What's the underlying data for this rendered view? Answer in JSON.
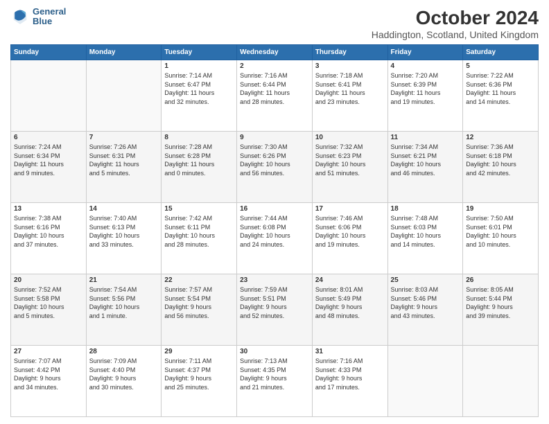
{
  "logo": {
    "line1": "General",
    "line2": "Blue"
  },
  "title": "October 2024",
  "subtitle": "Haddington, Scotland, United Kingdom",
  "header_days": [
    "Sunday",
    "Monday",
    "Tuesday",
    "Wednesday",
    "Thursday",
    "Friday",
    "Saturday"
  ],
  "weeks": [
    [
      {
        "day": "",
        "info": ""
      },
      {
        "day": "",
        "info": ""
      },
      {
        "day": "1",
        "info": "Sunrise: 7:14 AM\nSunset: 6:47 PM\nDaylight: 11 hours\nand 32 minutes."
      },
      {
        "day": "2",
        "info": "Sunrise: 7:16 AM\nSunset: 6:44 PM\nDaylight: 11 hours\nand 28 minutes."
      },
      {
        "day": "3",
        "info": "Sunrise: 7:18 AM\nSunset: 6:41 PM\nDaylight: 11 hours\nand 23 minutes."
      },
      {
        "day": "4",
        "info": "Sunrise: 7:20 AM\nSunset: 6:39 PM\nDaylight: 11 hours\nand 19 minutes."
      },
      {
        "day": "5",
        "info": "Sunrise: 7:22 AM\nSunset: 6:36 PM\nDaylight: 11 hours\nand 14 minutes."
      }
    ],
    [
      {
        "day": "6",
        "info": "Sunrise: 7:24 AM\nSunset: 6:34 PM\nDaylight: 11 hours\nand 9 minutes."
      },
      {
        "day": "7",
        "info": "Sunrise: 7:26 AM\nSunset: 6:31 PM\nDaylight: 11 hours\nand 5 minutes."
      },
      {
        "day": "8",
        "info": "Sunrise: 7:28 AM\nSunset: 6:28 PM\nDaylight: 11 hours\nand 0 minutes."
      },
      {
        "day": "9",
        "info": "Sunrise: 7:30 AM\nSunset: 6:26 PM\nDaylight: 10 hours\nand 56 minutes."
      },
      {
        "day": "10",
        "info": "Sunrise: 7:32 AM\nSunset: 6:23 PM\nDaylight: 10 hours\nand 51 minutes."
      },
      {
        "day": "11",
        "info": "Sunrise: 7:34 AM\nSunset: 6:21 PM\nDaylight: 10 hours\nand 46 minutes."
      },
      {
        "day": "12",
        "info": "Sunrise: 7:36 AM\nSunset: 6:18 PM\nDaylight: 10 hours\nand 42 minutes."
      }
    ],
    [
      {
        "day": "13",
        "info": "Sunrise: 7:38 AM\nSunset: 6:16 PM\nDaylight: 10 hours\nand 37 minutes."
      },
      {
        "day": "14",
        "info": "Sunrise: 7:40 AM\nSunset: 6:13 PM\nDaylight: 10 hours\nand 33 minutes."
      },
      {
        "day": "15",
        "info": "Sunrise: 7:42 AM\nSunset: 6:11 PM\nDaylight: 10 hours\nand 28 minutes."
      },
      {
        "day": "16",
        "info": "Sunrise: 7:44 AM\nSunset: 6:08 PM\nDaylight: 10 hours\nand 24 minutes."
      },
      {
        "day": "17",
        "info": "Sunrise: 7:46 AM\nSunset: 6:06 PM\nDaylight: 10 hours\nand 19 minutes."
      },
      {
        "day": "18",
        "info": "Sunrise: 7:48 AM\nSunset: 6:03 PM\nDaylight: 10 hours\nand 14 minutes."
      },
      {
        "day": "19",
        "info": "Sunrise: 7:50 AM\nSunset: 6:01 PM\nDaylight: 10 hours\nand 10 minutes."
      }
    ],
    [
      {
        "day": "20",
        "info": "Sunrise: 7:52 AM\nSunset: 5:58 PM\nDaylight: 10 hours\nand 5 minutes."
      },
      {
        "day": "21",
        "info": "Sunrise: 7:54 AM\nSunset: 5:56 PM\nDaylight: 10 hours\nand 1 minute."
      },
      {
        "day": "22",
        "info": "Sunrise: 7:57 AM\nSunset: 5:54 PM\nDaylight: 9 hours\nand 56 minutes."
      },
      {
        "day": "23",
        "info": "Sunrise: 7:59 AM\nSunset: 5:51 PM\nDaylight: 9 hours\nand 52 minutes."
      },
      {
        "day": "24",
        "info": "Sunrise: 8:01 AM\nSunset: 5:49 PM\nDaylight: 9 hours\nand 48 minutes."
      },
      {
        "day": "25",
        "info": "Sunrise: 8:03 AM\nSunset: 5:46 PM\nDaylight: 9 hours\nand 43 minutes."
      },
      {
        "day": "26",
        "info": "Sunrise: 8:05 AM\nSunset: 5:44 PM\nDaylight: 9 hours\nand 39 minutes."
      }
    ],
    [
      {
        "day": "27",
        "info": "Sunrise: 7:07 AM\nSunset: 4:42 PM\nDaylight: 9 hours\nand 34 minutes."
      },
      {
        "day": "28",
        "info": "Sunrise: 7:09 AM\nSunset: 4:40 PM\nDaylight: 9 hours\nand 30 minutes."
      },
      {
        "day": "29",
        "info": "Sunrise: 7:11 AM\nSunset: 4:37 PM\nDaylight: 9 hours\nand 25 minutes."
      },
      {
        "day": "30",
        "info": "Sunrise: 7:13 AM\nSunset: 4:35 PM\nDaylight: 9 hours\nand 21 minutes."
      },
      {
        "day": "31",
        "info": "Sunrise: 7:16 AM\nSunset: 4:33 PM\nDaylight: 9 hours\nand 17 minutes."
      },
      {
        "day": "",
        "info": ""
      },
      {
        "day": "",
        "info": ""
      }
    ]
  ]
}
